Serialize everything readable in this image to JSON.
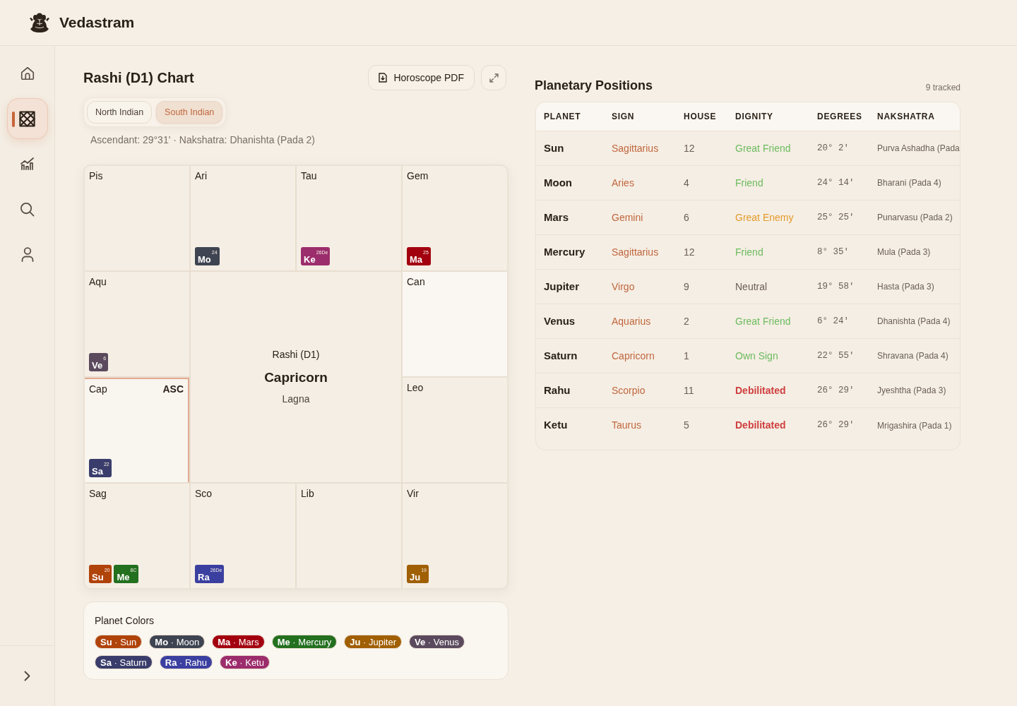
{
  "app": {
    "name": "Vedastram"
  },
  "sidebar": {
    "items": [
      {
        "kind": "home",
        "selected": false
      },
      {
        "kind": "chart",
        "selected": true
      },
      {
        "kind": "analytics",
        "selected": false
      },
      {
        "kind": "search",
        "selected": false
      },
      {
        "kind": "profile",
        "selected": false
      }
    ]
  },
  "chart_panel": {
    "title": "Rashi (D1) Chart",
    "actions": [
      {
        "kind": "pdf",
        "label": "Horoscope PDF"
      },
      {
        "kind": "expand"
      }
    ],
    "tabs": [
      {
        "label": "North Indian",
        "selected": false
      },
      {
        "label": "South Indian",
        "selected": true
      }
    ],
    "ascendant_info": "Ascendant: 29°31' · Nakshatra: Dhanishta (Pada 2)",
    "chart": {
      "center": {
        "title": "Rashi (D1)",
        "sign": "Capricorn",
        "caption": "Lagna"
      },
      "houses": [
        {
          "sign": "Pis",
          "ascendant": false,
          "hovered": false
        },
        {
          "sign": "Ari",
          "ascendant": false,
          "hovered": false,
          "planets": [
            {
              "abbr": "Mo",
              "degree": "24",
              "color": "#3e4451"
            }
          ]
        },
        {
          "sign": "Tau",
          "ascendant": false,
          "hovered": false,
          "planets": [
            {
              "abbr": "Ke",
              "degree": "26De",
              "color": "#9c2d6c"
            }
          ]
        },
        {
          "sign": "Gem",
          "ascendant": false,
          "hovered": false,
          "planets": [
            {
              "abbr": "Ma",
              "degree": "25",
              "color": "#a3000f"
            }
          ]
        },
        {
          "sign": "Aqu",
          "ascendant": false,
          "hovered": false,
          "planets": [
            {
              "abbr": "Ve",
              "degree": "6",
              "color": "#5b4a5e"
            }
          ]
        },
        {
          "sign": "Can",
          "ascendant": false,
          "hovered": true
        },
        {
          "sign": "Cap",
          "ascendant": true,
          "hovered": false,
          "tag": "ASC",
          "planets": [
            {
              "abbr": "Sa",
              "degree": "22",
              "color": "#3a3d6b"
            }
          ]
        },
        {
          "sign": "Leo",
          "ascendant": false,
          "hovered": false
        },
        {
          "sign": "Sag",
          "ascendant": false,
          "hovered": false,
          "planets": [
            {
              "abbr": "Su",
              "degree": "20",
              "color": "#b0430a"
            },
            {
              "abbr": "Me",
              "degree": "8C",
              "color": "#23701f"
            }
          ]
        },
        {
          "sign": "Sco",
          "ascendant": false,
          "hovered": false,
          "planets": [
            {
              "abbr": "Ra",
              "degree": "26De",
              "color": "#3b40a0"
            }
          ]
        },
        {
          "sign": "Lib",
          "ascendant": false,
          "hovered": false
        },
        {
          "sign": "Vir",
          "ascendant": false,
          "hovered": false,
          "planets": [
            {
              "abbr": "Ju",
              "degree": "19",
              "color": "#a05f00"
            }
          ]
        }
      ]
    }
  },
  "legend": {
    "title": "Planet Colors",
    "items": [
      {
        "label": "**Su** · Sun",
        "color": "#b0430a"
      },
      {
        "label": "**Mo** · Moon",
        "color": "#3e4451"
      },
      {
        "label": "**Ma** · Mars",
        "color": "#a3000f"
      },
      {
        "label": "**Me** · Mercury",
        "color": "#23701f"
      },
      {
        "label": "**Ju** · Jupiter",
        "color": "#a05f00"
      },
      {
        "label": "**Ve** · Venus",
        "color": "#5b4a5e"
      },
      {
        "label": "**Sa** · Saturn",
        "color": "#3a3d6b"
      },
      {
        "label": "**Ra** · Rahu",
        "color": "#3b40a0"
      },
      {
        "label": "**Ke** · Ketu",
        "color": "#9c2d6c"
      }
    ]
  },
  "positions": {
    "title": "Planetary Positions",
    "count": "9 tracked",
    "columns": [
      "PLANET",
      "SIGN",
      "HOUSE",
      "DIGNITY",
      "DEGREES",
      "NAKSHATRA"
    ],
    "rows": [
      {
        "planet": "Sun",
        "sign": "Sagittarius",
        "house": "12",
        "dignity": {
          "label": "Great Friend",
          "color": "#6cbb5f",
          "bold": false
        },
        "degrees": "20° 2'",
        "nakshatra": "Purva Ashadha (Pada"
      },
      {
        "planet": "Moon",
        "sign": "Aries",
        "house": "4",
        "dignity": {
          "label": "Friend",
          "color": "#6cbb5f",
          "bold": false
        },
        "degrees": "24° 14'",
        "nakshatra": "Bharani (Pada 4)"
      },
      {
        "planet": "Mars",
        "sign": "Gemini",
        "house": "6",
        "dignity": {
          "label": "Great Enemy",
          "color": "#e39b2b",
          "bold": false
        },
        "degrees": "25° 25'",
        "nakshatra": "Punarvasu (Pada 2)"
      },
      {
        "planet": "Mercury",
        "sign": "Sagittarius",
        "house": "12",
        "dignity": {
          "label": "Friend",
          "color": "#6cbb5f",
          "bold": false
        },
        "degrees": "8° 35'",
        "nakshatra": "Mula (Pada 3)"
      },
      {
        "planet": "Jupiter",
        "sign": "Virgo",
        "house": "9",
        "dignity": {
          "label": "Neutral",
          "color": "#6b6055",
          "bold": false
        },
        "degrees": "19° 58'",
        "nakshatra": "Hasta (Pada 3)"
      },
      {
        "planet": "Venus",
        "sign": "Aquarius",
        "house": "2",
        "dignity": {
          "label": "Great Friend",
          "color": "#6cbb5f",
          "bold": false
        },
        "degrees": "6° 24'",
        "nakshatra": "Dhanishta (Pada 4)"
      },
      {
        "planet": "Saturn",
        "sign": "Capricorn",
        "house": "1",
        "dignity": {
          "label": "Own Sign",
          "color": "#6cbb5f",
          "bold": false
        },
        "degrees": "22° 55'",
        "nakshatra": "Shravana (Pada 4)"
      },
      {
        "planet": "Rahu",
        "sign": "Scorpio",
        "house": "11",
        "dignity": {
          "label": "Debilitated",
          "color": "#cf4040",
          "bold": true
        },
        "degrees": "26° 29'",
        "nakshatra": "Jyeshtha (Pada 3)"
      },
      {
        "planet": "Ketu",
        "sign": "Taurus",
        "house": "5",
        "dignity": {
          "label": "Debilitated",
          "color": "#cf4040",
          "bold": true
        },
        "degrees": "26° 29'",
        "nakshatra": "Mrigashira (Pada 1)"
      }
    ]
  }
}
